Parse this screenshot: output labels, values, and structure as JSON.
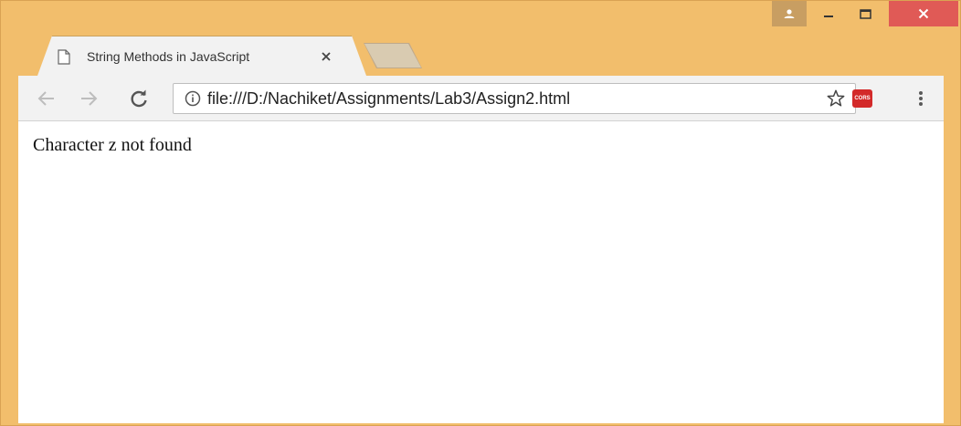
{
  "window": {
    "frame_color": "#F2BE6C",
    "close_color": "#E05A56",
    "controls": {
      "profile_icon": "person-icon",
      "minimize_icon": "minimize-icon",
      "maximize_icon": "maximize-icon",
      "close_icon": "close-icon"
    }
  },
  "tabs": [
    {
      "title": "String Methods in JavaScript",
      "icon": "page-icon",
      "active": true
    }
  ],
  "toolbar": {
    "back_icon": "arrow-left-icon",
    "forward_icon": "arrow-right-icon",
    "reload_icon": "reload-icon",
    "url": "file:///D:/Nachiket/Assignments/Lab3/Assign2.html",
    "info_icon": "info-icon",
    "bookmark_icon": "star-icon",
    "extension_label": "CORS",
    "extension_color": "#D32A2A",
    "menu_icon": "more-vert-icon"
  },
  "page": {
    "text": "Character z not found"
  }
}
